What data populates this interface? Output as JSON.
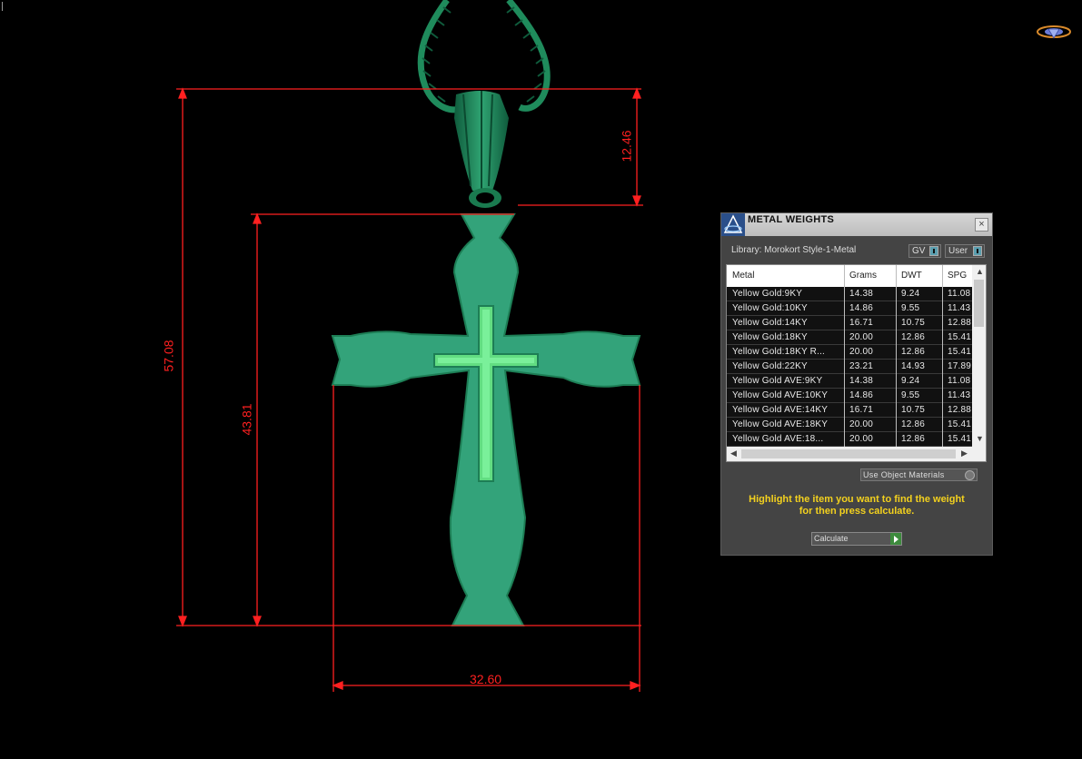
{
  "viewport": {
    "dimensions": {
      "height_total": "57.08",
      "height_cross": "43.81",
      "height_bail": "12.46",
      "width": "32.60"
    },
    "colors": {
      "dimension_line": "#ff2020",
      "model_body": "#33a37a",
      "model_dark": "#1d7e55",
      "model_light": "#62dd82",
      "background": "#000000"
    }
  },
  "panel": {
    "title": "METAL WEIGHTS",
    "close_label": "×",
    "library": "Library: Morokort Style-1-Metal",
    "toggle_gv": "GV",
    "toggle_user": "User",
    "columns": [
      "Metal",
      "Grams",
      "DWT",
      "SPG"
    ],
    "rows": [
      [
        "Yellow Gold:9KY",
        "14.38",
        "9.24",
        "11.08"
      ],
      [
        "Yellow Gold:10KY",
        "14.86",
        "9.55",
        "11.43"
      ],
      [
        "Yellow Gold:14KY",
        "16.71",
        "10.75",
        "12.88"
      ],
      [
        "Yellow Gold:18KY",
        "20.00",
        "12.86",
        "15.41"
      ],
      [
        "Yellow Gold:18KY R...",
        "20.00",
        "12.86",
        "15.41"
      ],
      [
        "Yellow Gold:22KY",
        "23.21",
        "14.93",
        "17.89"
      ],
      [
        "Yellow Gold AVE:9KY",
        "14.38",
        "9.24",
        "11.08"
      ],
      [
        "Yellow Gold AVE:10KY",
        "14.86",
        "9.55",
        "11.43"
      ],
      [
        "Yellow Gold AVE:14KY",
        "16.71",
        "10.75",
        "12.88"
      ],
      [
        "Yellow Gold AVE:18KY",
        "20.00",
        "12.86",
        "15.41"
      ],
      [
        "Yellow Gold AVE:18...",
        "20.00",
        "12.86",
        "15.41"
      ]
    ],
    "use_object_materials": "Use Object Materials",
    "instruction_line1": "Highlight the item you want to find the weight",
    "instruction_line2": "for then press calculate.",
    "calculate_label": "Calculate",
    "instruction_color": "#f3d11e"
  }
}
